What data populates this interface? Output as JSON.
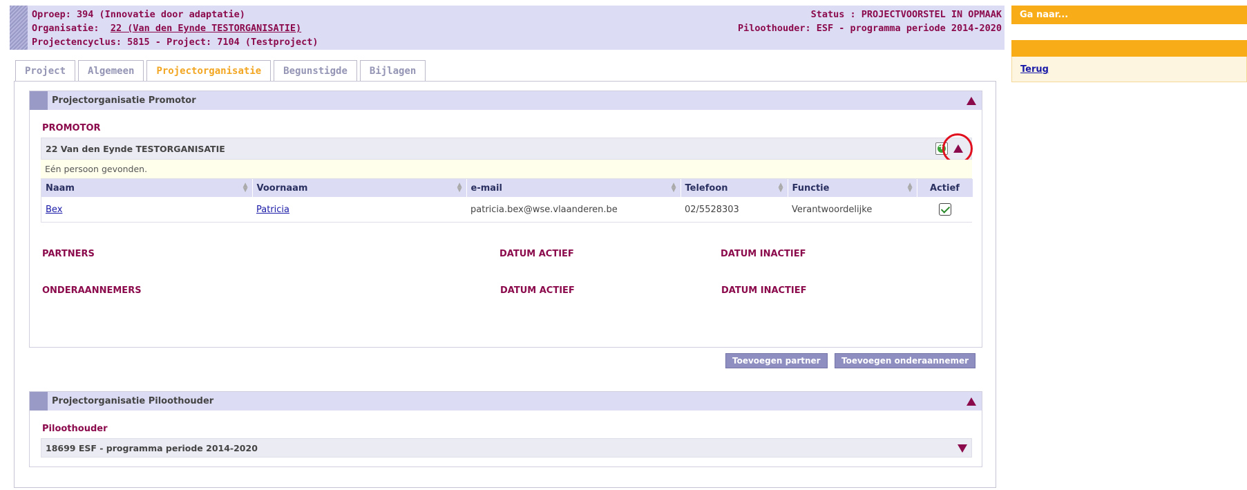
{
  "header": {
    "line1": "Oproep: 394 (Innovatie door adaptatie)",
    "org_prefix": "Organisatie:",
    "org_link": "22 (Van den Eynde TESTORGANISATIE)",
    "line3": "Projectencyclus: 5815 -  Project: 7104 (Testproject)",
    "status": "Status : PROJECTVOORSTEL IN OPMAAK",
    "piloothouder": "Piloothouder: ESF - programma periode 2014-2020"
  },
  "tabs": [
    {
      "label": "Project"
    },
    {
      "label": "Algemeen"
    },
    {
      "label": "Projectorganisatie"
    },
    {
      "label": "Begunstigde"
    },
    {
      "label": "Bijlagen"
    }
  ],
  "active_tab": "Projectorganisatie",
  "promotor_section": {
    "title": "Projectorganisatie Promotor",
    "promotor_label": "PROMOTOR",
    "org_name": "22 Van den Eynde TESTORGANISATIE",
    "found_text": "Eén persoon gevonden.",
    "columns": [
      "Naam",
      "Voornaam",
      "e-mail",
      "Telefoon",
      "Functie",
      "Actief"
    ],
    "rows": [
      {
        "naam": "Bex",
        "voornaam": "Patricia",
        "email": "patricia.bex@wse.vlaanderen.be",
        "telefoon": "02/5528303",
        "functie": "Verantwoordelijke",
        "actief": true
      }
    ],
    "partners_label": "PARTNERS",
    "onderaannemers_label": "ONDERAANNEMERS",
    "datum_actief": "DATUM ACTIEF",
    "datum_inactief": "DATUM INACTIEF"
  },
  "buttons": {
    "add_partner": "Toevoegen partner",
    "add_onderaannemer": "Toevoegen onderaannemer"
  },
  "pilot_section": {
    "title": "Projectorganisatie Piloothouder",
    "label": "Piloothouder",
    "name": "18699 ESF - programma periode 2014-2020"
  },
  "sidebar": {
    "goto_label": "Ga naar...",
    "back_link": "Terug"
  },
  "colors": {
    "maroon": "#8b0a4c",
    "lavender": "#dcdcf4",
    "orange": "#f8ad18",
    "tab_active": "#f2a622"
  }
}
